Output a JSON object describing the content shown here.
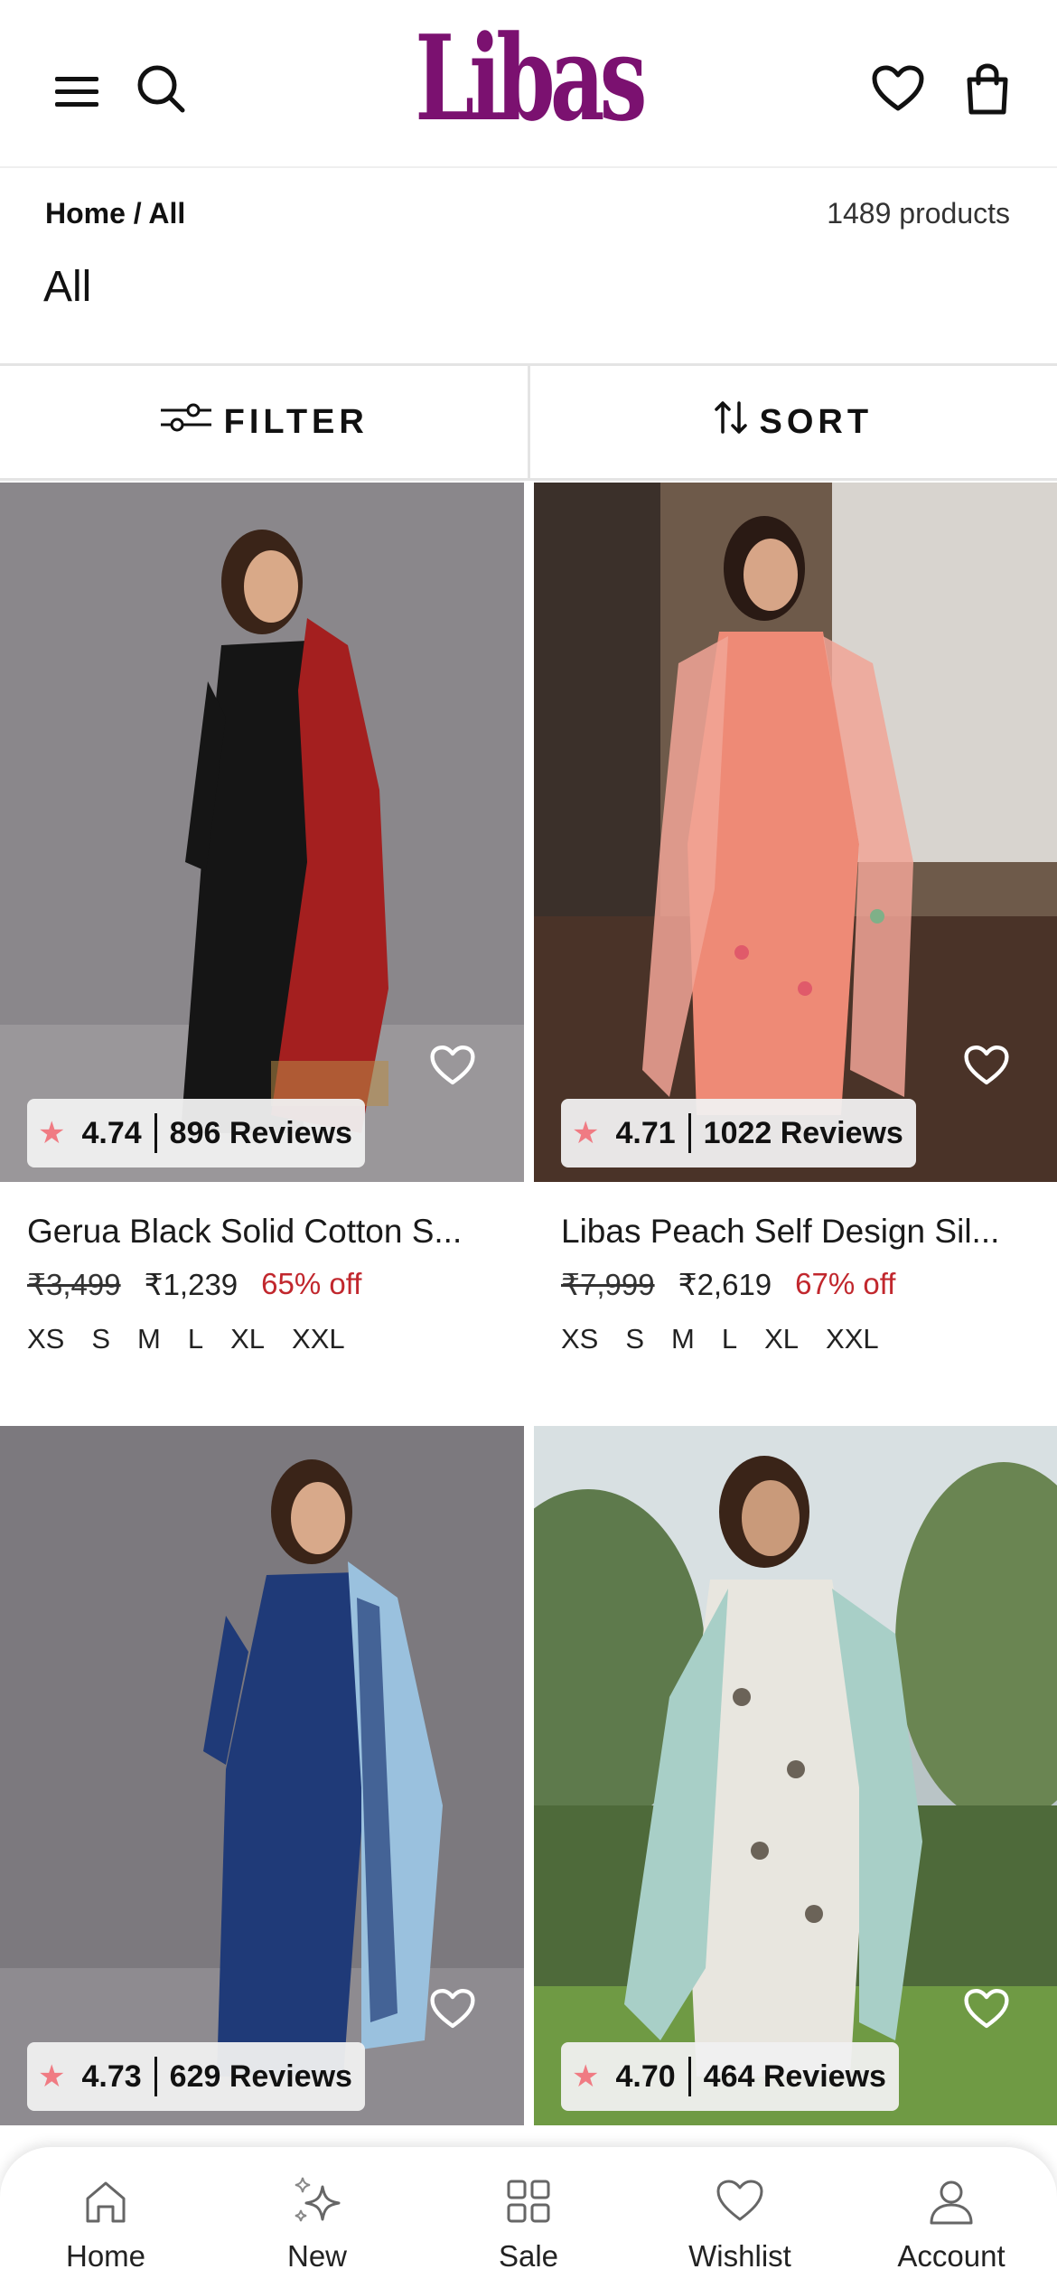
{
  "header": {
    "logo": "Libas",
    "icons": [
      "hamburger-menu-icon",
      "search-icon",
      "heart-icon",
      "shopping-bag-icon"
    ]
  },
  "breadcrumb": "Home / All",
  "product_count": "1489 products",
  "page_title": "All",
  "toolbar": {
    "filter_label": "FILTER",
    "sort_label": "SORT"
  },
  "colors": {
    "brand": "#7b1170",
    "discount": "#c1272d",
    "star": "#f07b83"
  },
  "products": [
    {
      "rating": "4.74",
      "reviews": "896 Reviews",
      "name": "Gerua Black Solid Cotton S...",
      "mrp": "₹3,499",
      "price": "₹1,239",
      "discount": "65% off",
      "sizes": [
        "XS",
        "S",
        "M",
        "L",
        "XL",
        "XXL"
      ]
    },
    {
      "rating": "4.71",
      "reviews": "1022 Reviews",
      "name": "Libas Peach Self Design Sil...",
      "mrp": "₹7,999",
      "price": "₹2,619",
      "discount": "67% off",
      "sizes": [
        "XS",
        "S",
        "M",
        "L",
        "XL",
        "XXL"
      ]
    },
    {
      "rating": "4.73",
      "reviews": "629 Reviews"
    },
    {
      "rating": "4.70",
      "reviews": "464 Reviews"
    }
  ],
  "bottom_nav": [
    {
      "label": "Home",
      "icon": "home-icon"
    },
    {
      "label": "New",
      "icon": "sparkle-icon"
    },
    {
      "label": "Sale",
      "icon": "grid-icon"
    },
    {
      "label": "Wishlist",
      "icon": "heart-icon"
    },
    {
      "label": "Account",
      "icon": "user-icon"
    }
  ]
}
